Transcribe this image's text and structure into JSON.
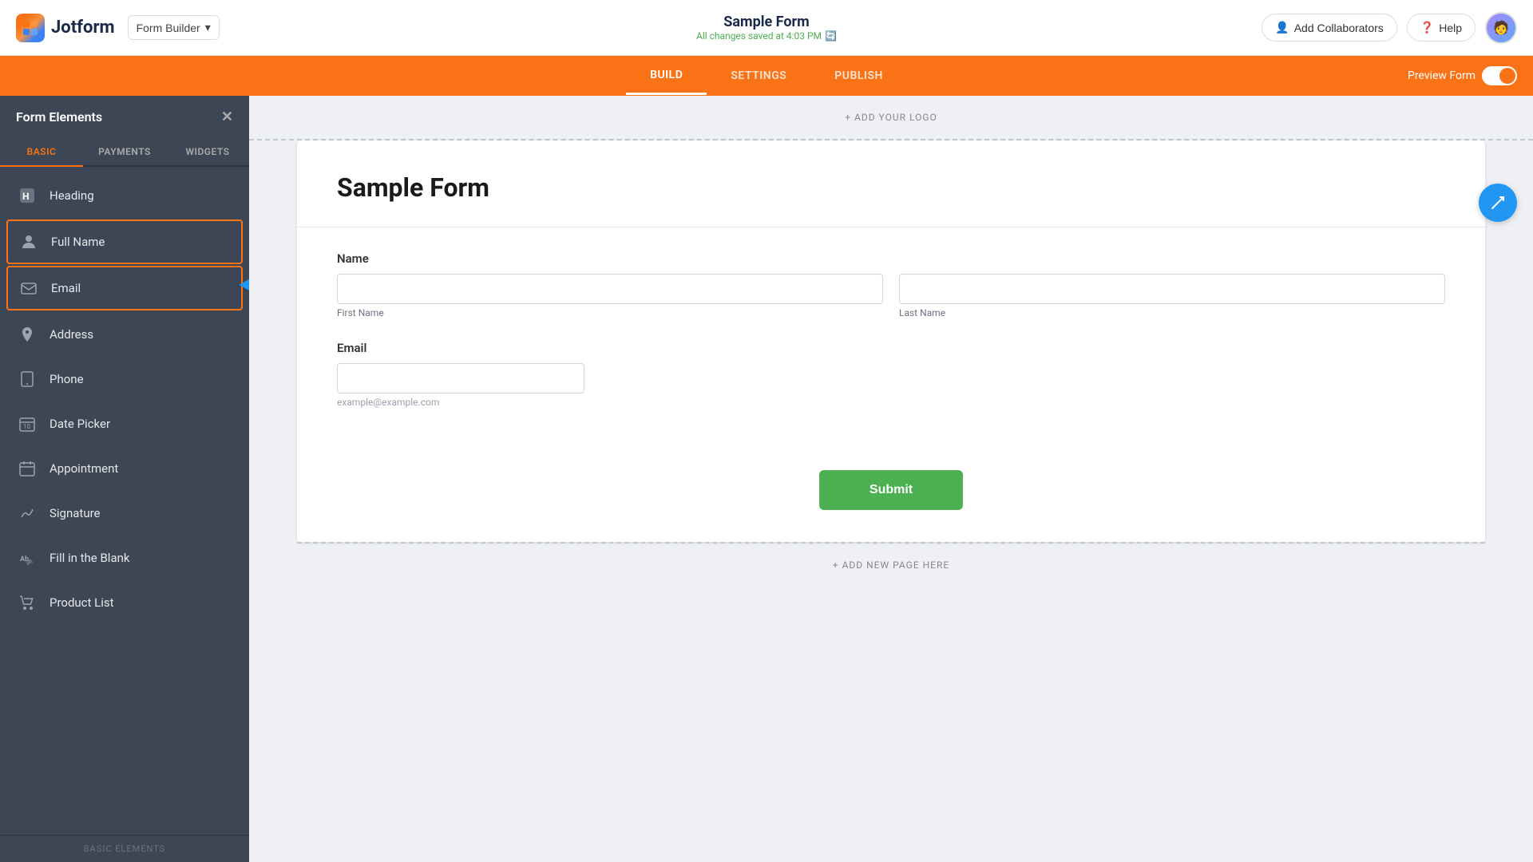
{
  "logo": {
    "brand_name": "Jotform"
  },
  "top_nav": {
    "form_builder_label": "Form Builder",
    "form_title": "Sample Form",
    "saved_status": "All changes saved at 4:03 PM",
    "add_collaborators_label": "Add Collaborators",
    "help_label": "Help",
    "preview_form_label": "Preview Form"
  },
  "tabs": {
    "build_label": "BUILD",
    "settings_label": "SETTINGS",
    "publish_label": "PUBLISH",
    "active": "BUILD"
  },
  "sidebar": {
    "title": "Form Elements",
    "close_icon": "✕",
    "tabs": [
      {
        "label": "BASIC",
        "active": true
      },
      {
        "label": "PAYMENTS",
        "active": false
      },
      {
        "label": "WIDGETS",
        "active": false
      }
    ],
    "items": [
      {
        "label": "Heading",
        "icon": "H",
        "highlighted": false
      },
      {
        "label": "Full Name",
        "icon": "👤",
        "highlighted": true
      },
      {
        "label": "Email",
        "icon": "✉",
        "highlighted": true
      },
      {
        "label": "Address",
        "icon": "📍",
        "highlighted": false
      },
      {
        "label": "Phone",
        "icon": "📞",
        "highlighted": false
      },
      {
        "label": "Date Picker",
        "icon": "📅",
        "highlighted": false
      },
      {
        "label": "Appointment",
        "icon": "📋",
        "highlighted": false
      },
      {
        "label": "Signature",
        "icon": "✏",
        "highlighted": false
      },
      {
        "label": "Fill in the Blank",
        "icon": "Ab",
        "highlighted": false
      },
      {
        "label": "Product List",
        "icon": "🛒",
        "highlighted": false
      }
    ],
    "footer_label": "BASIC ELEMENTS"
  },
  "form_canvas": {
    "add_logo_text": "+ ADD YOUR LOGO",
    "add_page_text": "+ ADD NEW PAGE HERE",
    "form_heading": "Sample Form",
    "name_field_label": "Name",
    "first_name_sublabel": "First Name",
    "last_name_sublabel": "Last Name",
    "email_field_label": "Email",
    "email_hint": "example@example.com",
    "submit_button_label": "Submit"
  }
}
